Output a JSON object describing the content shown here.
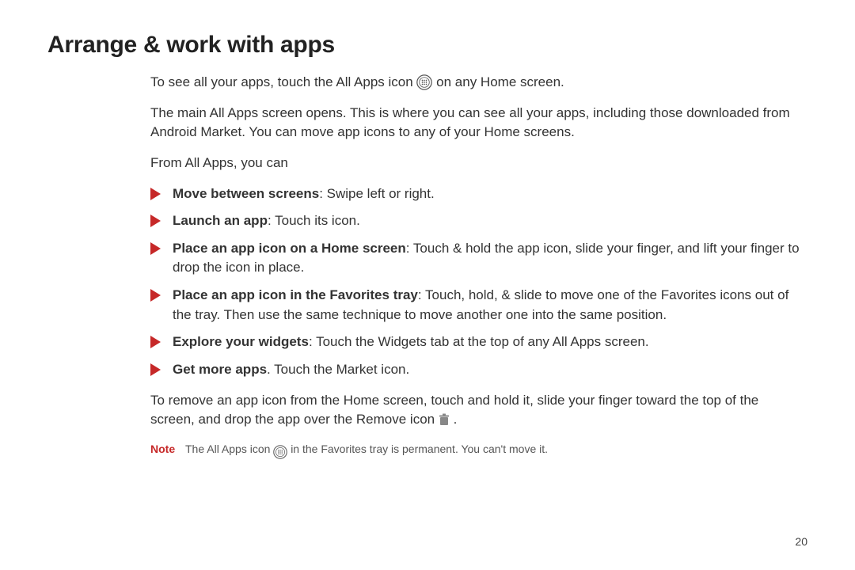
{
  "title": "Arrange & work with apps",
  "para1_a": "To see all your apps, touch the All Apps icon ",
  "para1_b": " on any Home screen.",
  "para2": "The main All Apps screen opens. This is where you can see all your apps, including those downloaded from Android Market. You can move app icons to any of your Home screens.",
  "para3": "From All Apps, you can",
  "bullets": [
    {
      "bold": "Move between screens",
      "rest": ": Swipe left or right."
    },
    {
      "bold": "Launch an app",
      "rest": ": Touch its icon."
    },
    {
      "bold": "Place an app icon on a Home screen",
      "rest": ": Touch & hold the app icon, slide your finger, and lift your finger to drop the icon in place."
    },
    {
      "bold": "Place an app icon in the Favorites tray",
      "rest": ": Touch, hold, & slide to move one of the Favorites icons out of the tray. Then use the same technique to move another one into the same position."
    },
    {
      "bold": "Explore your widgets",
      "rest": ": Touch the Widgets tab at the top of any All Apps screen."
    },
    {
      "bold": "Get more apps",
      "rest": ". Touch the Market icon."
    }
  ],
  "para4_a": "To remove an app icon from the Home screen, touch and hold it, slide your finger toward the top of the screen, and drop the app over the Remove icon ",
  "para4_b": " .",
  "note": {
    "label": "Note",
    "text_a": "The All Apps icon ",
    "text_b": " in the Favorites tray is permanent. You can't move it."
  },
  "page_number": "20"
}
